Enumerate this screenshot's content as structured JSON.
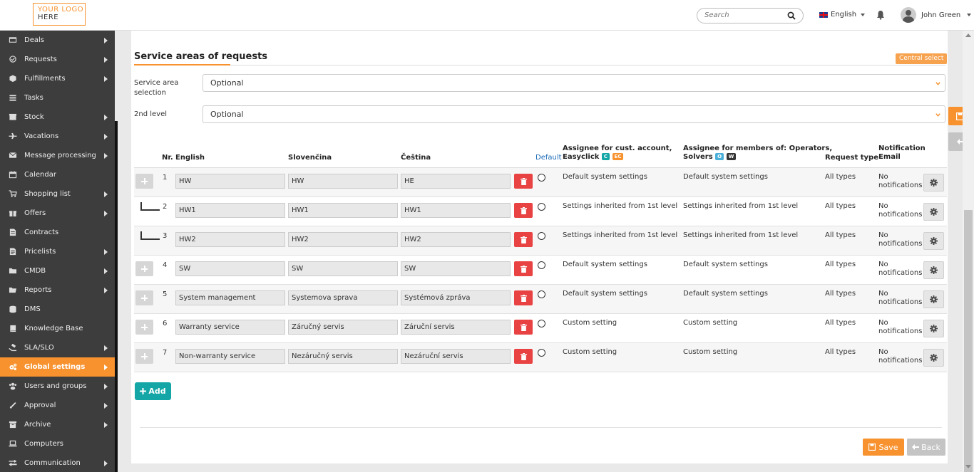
{
  "header": {
    "logo_line1": "YOUR LOGO",
    "logo_line2": "HERE",
    "search_placeholder": "Search",
    "language": "English",
    "user_name": "John Green"
  },
  "sidebar": {
    "items": [
      {
        "label": "Deals",
        "icon": "deals-icon",
        "submenu": true
      },
      {
        "label": "Requests",
        "icon": "requests-icon",
        "submenu": true
      },
      {
        "label": "Fulfillments",
        "icon": "fulfillments-icon",
        "submenu": true
      },
      {
        "label": "Tasks",
        "icon": "tasks-icon",
        "submenu": false
      },
      {
        "label": "Stock",
        "icon": "stock-icon",
        "submenu": true
      },
      {
        "label": "Vacations",
        "icon": "plane-icon",
        "submenu": true
      },
      {
        "label": "Message processing",
        "icon": "envelope-icon",
        "submenu": true
      },
      {
        "label": "Calendar",
        "icon": "calendar-icon",
        "submenu": false
      },
      {
        "label": "Shopping list",
        "icon": "cart-icon",
        "submenu": true
      },
      {
        "label": "Offers",
        "icon": "gift-icon",
        "submenu": true
      },
      {
        "label": "Contracts",
        "icon": "contract-icon",
        "submenu": false
      },
      {
        "label": "Pricelists",
        "icon": "pricelist-icon",
        "submenu": true
      },
      {
        "label": "CMDB",
        "icon": "folder-icon",
        "submenu": true
      },
      {
        "label": "Reports",
        "icon": "reports-icon",
        "submenu": true
      },
      {
        "label": "DMS",
        "icon": "database-icon",
        "submenu": false
      },
      {
        "label": "Knowledge Base",
        "icon": "book-icon",
        "submenu": false
      },
      {
        "label": "SLA/SLO",
        "icon": "gavel-icon",
        "submenu": true
      },
      {
        "label": "Global settings",
        "icon": "cogs-icon",
        "submenu": true,
        "active": true
      },
      {
        "label": "Users and groups",
        "icon": "users-icon",
        "submenu": true
      },
      {
        "label": "Approval",
        "icon": "approval-icon",
        "submenu": true
      },
      {
        "label": "Archive",
        "icon": "archive-icon",
        "submenu": true
      },
      {
        "label": "Computers",
        "icon": "laptop-icon",
        "submenu": false
      },
      {
        "label": "Communication",
        "icon": "exchange-icon",
        "submenu": true
      }
    ]
  },
  "section": {
    "title": "Service areas of requests",
    "central_select": "Central select",
    "service_area_label": "Service area selection",
    "service_area_value": "Optional",
    "second_level_label": "2nd level",
    "second_level_value": "Optional"
  },
  "table": {
    "headers": {
      "nr": "Nr.",
      "english": "English",
      "slovencina": "Slovenčina",
      "cestina": "Čeština",
      "default": "Default",
      "assignee_cust_line1": "Assignee for cust. account,",
      "assignee_cust_line2": "Easyclick",
      "badge_c": "C",
      "badge_ec": "EC",
      "assignee_members_line1": "Assignee for members of: Operators,",
      "assignee_members_line2": "Solvers",
      "badge_o": "O",
      "badge_w": "W",
      "request_type": "Request type",
      "notification_line1": "Notification",
      "notification_line2": "Email"
    },
    "rows": [
      {
        "nr": "1",
        "en": "HW",
        "sk": "HW",
        "cz": "HE",
        "assignee_cust": "Default system settings",
        "assignee_members": "Default system settings",
        "request_type": "All types",
        "notif1": "No",
        "notif2": "notifications",
        "level": 1
      },
      {
        "nr": "2",
        "en": "HW1",
        "sk": "HW1",
        "cz": "HW1",
        "assignee_cust": "Settings inherited from 1st level",
        "assignee_members": "Settings inherited from 1st level",
        "request_type": "All types",
        "notif1": "No",
        "notif2": "notifications",
        "level": 2
      },
      {
        "nr": "3",
        "en": "HW2",
        "sk": "HW2",
        "cz": "HW2",
        "assignee_cust": "Settings inherited from 1st level",
        "assignee_members": "Settings inherited from 1st level",
        "request_type": "All types",
        "notif1": "No",
        "notif2": "notifications",
        "level": 2
      },
      {
        "nr": "4",
        "en": "SW",
        "sk": "SW",
        "cz": "SW",
        "assignee_cust": "Default system settings",
        "assignee_members": "Default system settings",
        "request_type": "All types",
        "notif1": "No",
        "notif2": "notifications",
        "level": 1
      },
      {
        "nr": "5",
        "en": "System management",
        "sk": "Systemova sprava",
        "cz": "Systémová zpráva",
        "assignee_cust": "Default system settings",
        "assignee_members": "Default system settings",
        "request_type": "All types",
        "notif1": "No",
        "notif2": "notifications",
        "level": 1
      },
      {
        "nr": "6",
        "en": "Warranty service",
        "sk": "Záručný servis",
        "cz": "Záruční servis",
        "assignee_cust": "Custom setting",
        "assignee_members": "Custom setting",
        "request_type": "All types",
        "notif1": "No",
        "notif2": "notifications",
        "level": 1
      },
      {
        "nr": "7",
        "en": "Non-warranty service",
        "sk": "Nezáručný servis",
        "cz": "Nezáruční servis",
        "assignee_cust": "Custom setting",
        "assignee_members": "Custom setting",
        "request_type": "All types",
        "notif1": "No",
        "notif2": "notifications",
        "level": 1
      }
    ]
  },
  "actions": {
    "add": "Add",
    "save": "Save",
    "back": "Back"
  },
  "colors": {
    "accent": "#f7922e",
    "teal": "#14a6a6",
    "danger": "#e84242",
    "sidebar_bg": "#3d3d3d"
  }
}
